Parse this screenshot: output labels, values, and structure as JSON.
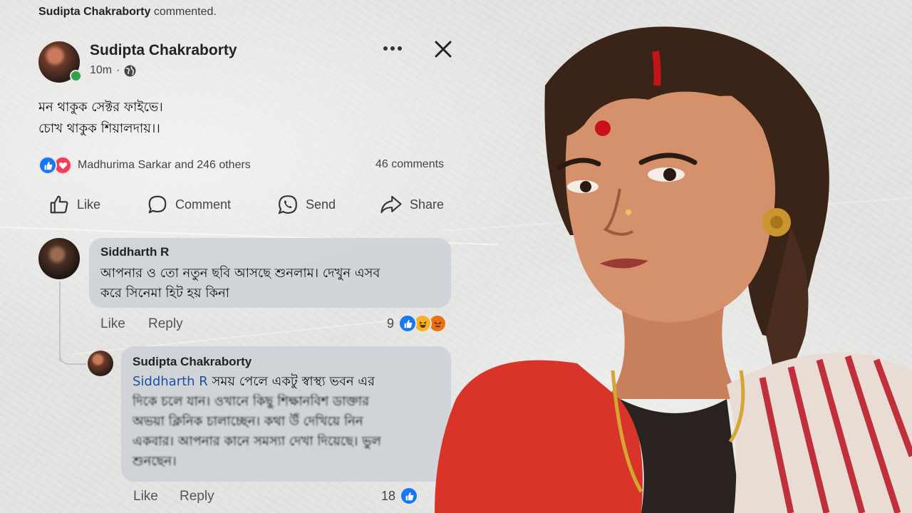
{
  "notification": {
    "author": "Sudipta Chakraborty",
    "suffix": "commented."
  },
  "post": {
    "author": "Sudipta Chakraborty",
    "time": "10m",
    "lines": [
      "মন থাকুক সেক্টর ফাইভে।",
      "চোখ থাকুক শিয়ালদায়।।"
    ],
    "reactions_text": "Madhurima Sarkar and 246 others",
    "comments_text": "46 comments"
  },
  "actions": {
    "like": "Like",
    "comment": "Comment",
    "send": "Send",
    "share": "Share"
  },
  "comment1": {
    "author": "Siddharth R",
    "lines": [
      "আপনার ও তো নতুন ছবি আসছে শুনলাম। দেখুন এসব",
      "করে সিনেমা হিট হয় কিনা"
    ],
    "like": "Like",
    "reply": "Reply",
    "reaction_count": "9"
  },
  "reply1": {
    "author": "Sudipta Chakraborty",
    "mention": "Siddharth R",
    "line1_rest": " সময় পেলে একটু স্বাস্থ্য ভবন এর",
    "lines": [
      "দিকে চলে যান। ওখানে কিছু শিক্ষানবিশ ডাক্তার",
      "অভয়া ক্লিনিক চালাচ্ছেন। কথা উঁ দেখিয়ে নিন",
      "একবার। আপনার কানে সমস্যা দেখা দিয়েছে। ভুল",
      "শুনছেন।"
    ],
    "like": "Like",
    "reply": "Reply",
    "reaction_count": "18"
  },
  "colors": {
    "fb_blue": "#1877f2",
    "love_red": "#f33e58",
    "haha_yellow": "#f7b125",
    "angry_orange": "#e9710f",
    "online_green": "#31a24c"
  }
}
